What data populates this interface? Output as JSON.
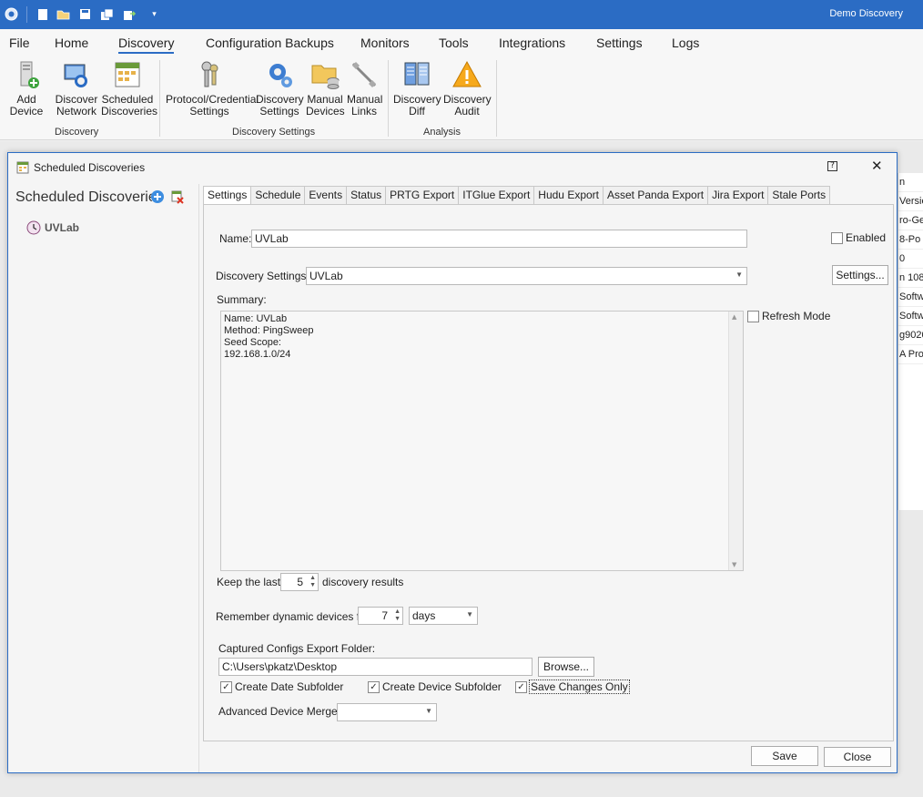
{
  "app": {
    "title": "Demo Discovery"
  },
  "menu": [
    "File",
    "Home",
    "Discovery",
    "Configuration Backups",
    "Monitors",
    "Tools",
    "Integrations",
    "Settings",
    "Logs"
  ],
  "ribbon": {
    "buttons": [
      {
        "line1": "Add Device",
        "line2": ""
      },
      {
        "line1": "Discover",
        "line2": "Network"
      },
      {
        "line1": "Scheduled",
        "line2": "Discoveries"
      },
      {
        "line1": "Protocol/Credential",
        "line2": "Settings"
      },
      {
        "line1": "Discovery",
        "line2": "Settings"
      },
      {
        "line1": "Manual",
        "line2": "Devices"
      },
      {
        "line1": "Manual",
        "line2": "Links"
      },
      {
        "line1": "Discovery",
        "line2": "Diff"
      },
      {
        "line1": "Discovery",
        "line2": "Audit"
      }
    ],
    "groups": [
      "Discovery",
      "Discovery Settings",
      "Analysis"
    ]
  },
  "background_right": [
    "n",
    "Versio",
    "ro-Ge",
    "8-Po",
    "0",
    "n 108",
    "Softw",
    "Softw",
    "g9020",
    "A ProC"
  ],
  "dialog": {
    "title": "Scheduled Discoveries",
    "help_glyph": "?",
    "close_glyph": "✕",
    "left": {
      "title": "Scheduled Discoveries",
      "items": [
        "UVLab"
      ]
    },
    "tabs": [
      "Settings",
      "Schedule",
      "Events",
      "Status",
      "PRTG Export",
      "ITGlue Export",
      "Hudu Export",
      "Asset Panda Export",
      "Jira Export",
      "Stale Ports"
    ],
    "form": {
      "name_label": "Name:",
      "name_value": "UVLab",
      "enabled_label": "Enabled",
      "enabled": false,
      "discovery_settings_label": "Discovery Settings:",
      "discovery_settings_value": "UVLab",
      "settings_button": "Settings...",
      "summary_label": "Summary:",
      "summary_text": "Name: UVLab\nMethod: PingSweep\nSeed Scope:\n192.168.1.0/24",
      "refresh_mode_label": "Refresh Mode",
      "refresh_mode": false,
      "keep_last_label": "Keep the last",
      "keep_last_value": "5",
      "keep_last_suffix": "discovery results",
      "remember_label": "Remember dynamic devices for",
      "remember_value": "7",
      "remember_unit": "days",
      "export_folder_label": "Captured Configs Export Folder:",
      "export_folder_value": "C:\\Users\\pkatz\\Desktop",
      "browse_button": "Browse...",
      "create_date_subfolder": "Create Date Subfolder",
      "create_device_subfolder": "Create Device Subfolder",
      "save_changes_only": "Save Changes Only",
      "advanced_merge_label": "Advanced Device Merge:",
      "advanced_merge_value": ""
    },
    "buttons": {
      "save": "Save",
      "close": "Close"
    }
  }
}
